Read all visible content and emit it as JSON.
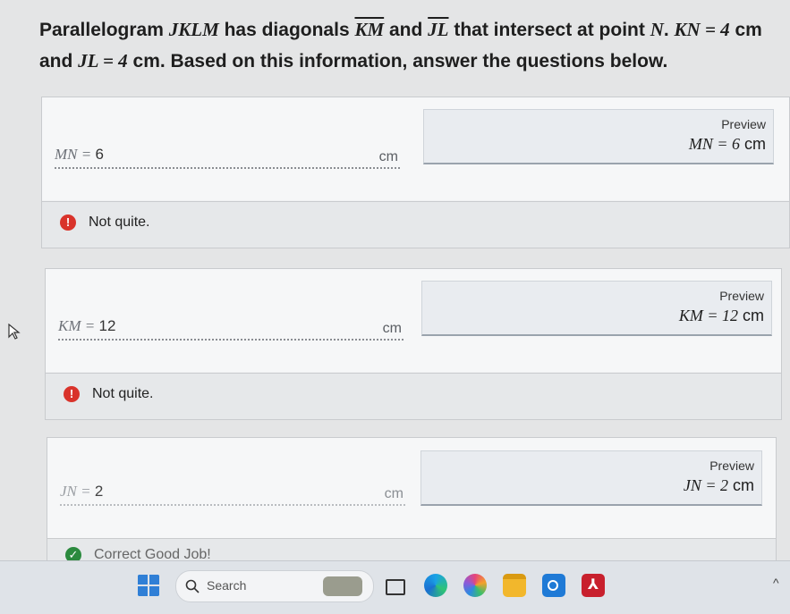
{
  "question": {
    "p1": "Parallelogram ",
    "shape": "JKLM",
    "p2": " has diagonals ",
    "d1": "KM",
    "p3": " and ",
    "d2": "JL",
    "p4": " that intersect at point ",
    "pt": "N",
    "p5": ". ",
    "kn": "KN = 4",
    "p6": " cm and ",
    "jl": "JL = 4",
    "p7": " cm. Based on this information, answer the questions below."
  },
  "parts": [
    {
      "label": "MN = ",
      "value": "6",
      "unit": "cm",
      "preview_title": "Preview",
      "preview_math": "MN = 6",
      "preview_unit": "cm",
      "feedback": "Not quite."
    },
    {
      "label": "KM = ",
      "value": "12",
      "unit": "cm",
      "preview_title": "Preview",
      "preview_math": "KM = 12",
      "preview_unit": "cm",
      "feedback": "Not quite."
    },
    {
      "label": "JN = ",
      "value": "2",
      "unit": "cm",
      "preview_title": "Preview",
      "preview_math": "JN = 2",
      "preview_unit": "cm",
      "feedback": "Correct Good Job!"
    }
  ],
  "taskbar": {
    "search_label": "Search"
  },
  "colors": {
    "error": "#d9332b",
    "success": "#2b8a3e",
    "windows_blue": "#2f7fd6"
  }
}
